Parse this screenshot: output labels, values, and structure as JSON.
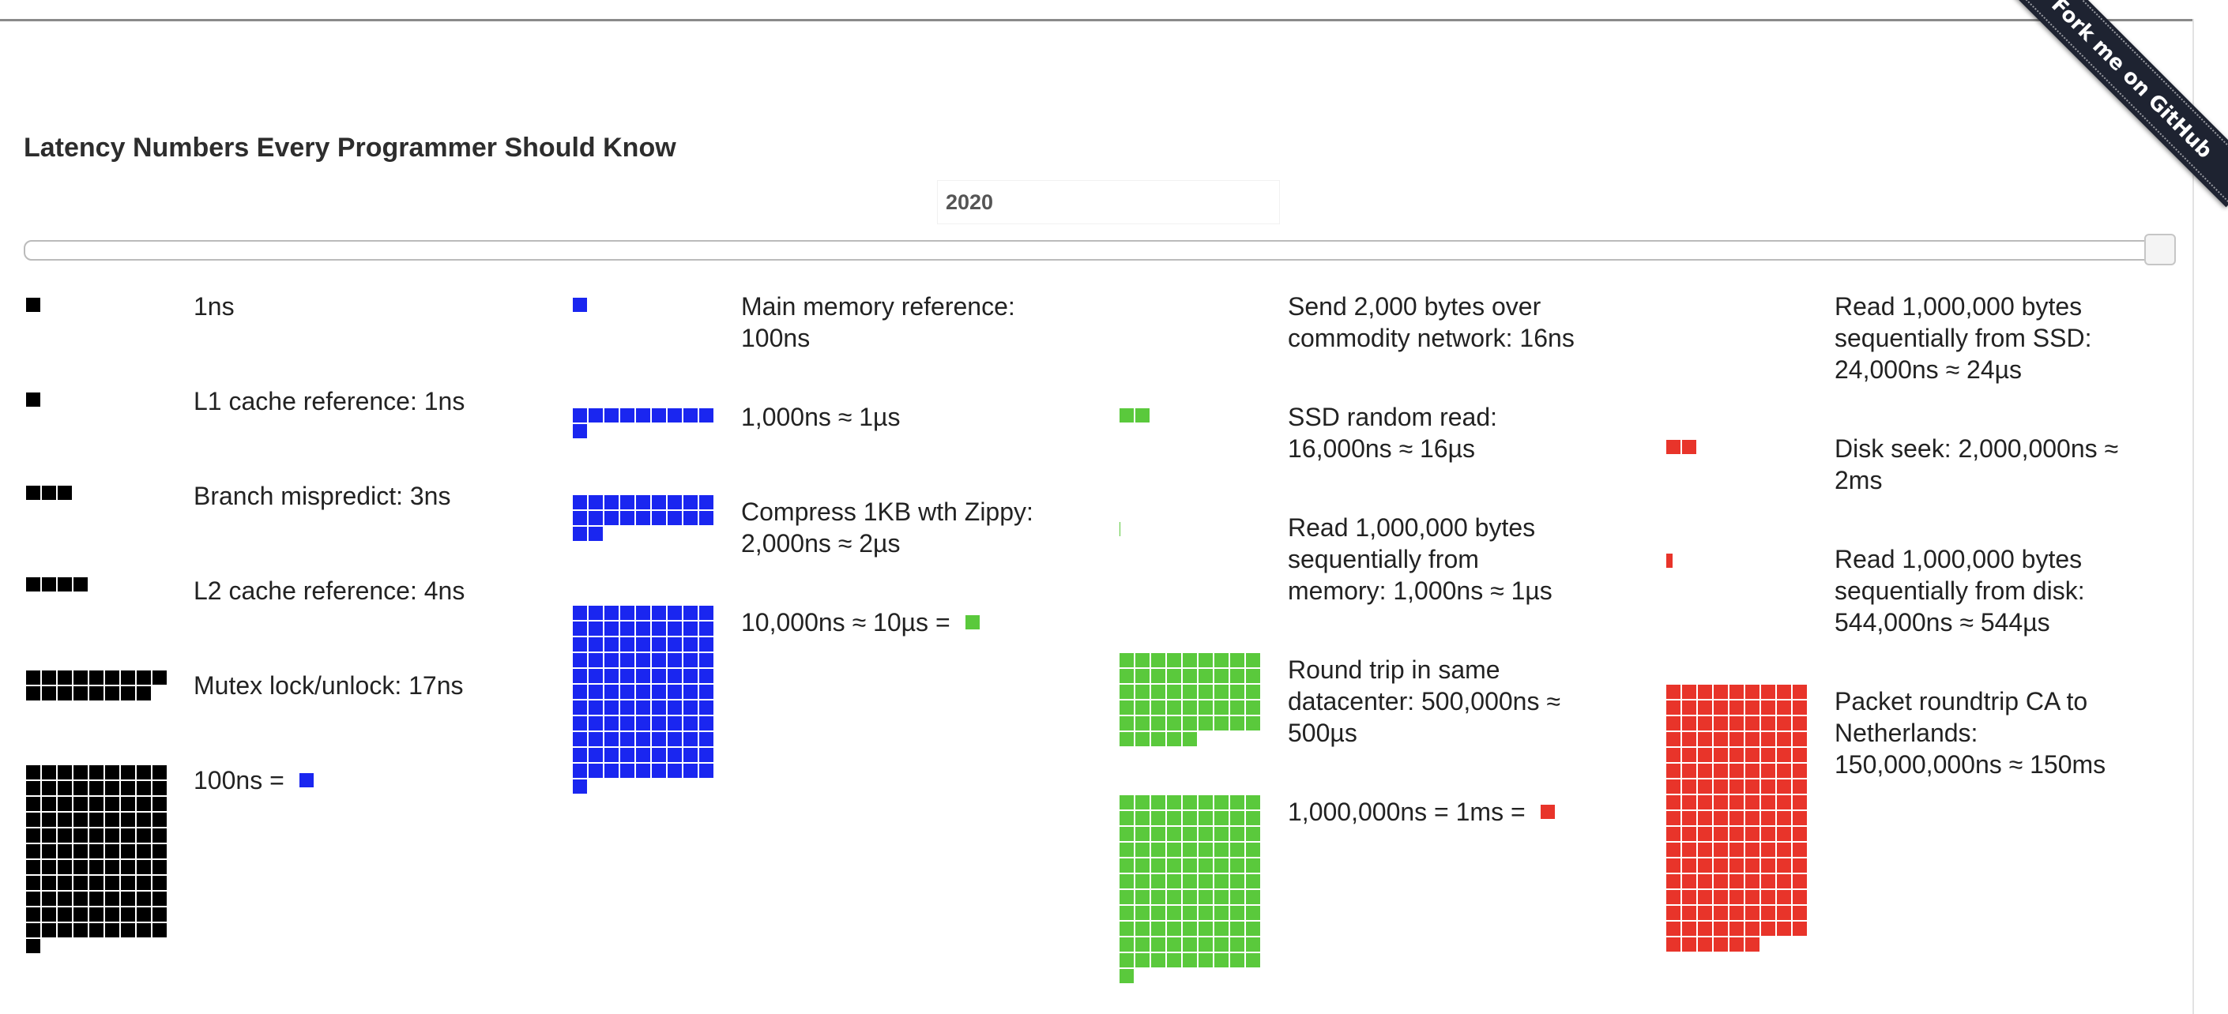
{
  "github_ribbon": "Fork me on GitHub",
  "title": "Latency Numbers Every Programmer Should Know",
  "year": "2020",
  "year_slider": {
    "value": "2020"
  },
  "colors": {
    "black": "#000000",
    "blue": "#1a26f0",
    "green": "#5ac93c",
    "red": "#e8342a"
  },
  "latencies": {
    "one_ns": {
      "label": "1ns",
      "count": 1,
      "color": "black"
    },
    "l1": {
      "label": "L1 cache reference: 1ns",
      "count": 1,
      "color": "black"
    },
    "branch": {
      "label": "Branch mispredict: 3ns",
      "count": 3,
      "color": "black"
    },
    "l2": {
      "label": "L2 cache reference: 4ns",
      "count": 4,
      "color": "black"
    },
    "mutex": {
      "label": "Mutex lock/unlock: 17ns",
      "count": 17,
      "color": "black"
    },
    "hundred_ns": {
      "label": "100ns = ",
      "count": 100,
      "color": "black",
      "equals": "blue"
    },
    "main_memory": {
      "line1": "Main memory reference:",
      "line2": "100ns",
      "count": 1,
      "color": "blue"
    },
    "one_us": {
      "label": "1,000ns ≈ 1µs",
      "count": 10,
      "color": "blue"
    },
    "compress": {
      "line1": "Compress 1KB wth Zippy:",
      "line2": "2,000ns ≈ 2µs",
      "count": 20,
      "color": "blue"
    },
    "ten_us": {
      "label": "10,000ns ≈ 10µs = ",
      "count": 100,
      "color": "blue",
      "equals": "green"
    },
    "network": {
      "line1": "Send 2,000 bytes over",
      "line2": "commodity network: 16ns",
      "count": 0,
      "color": "green"
    },
    "ssd_random": {
      "line1": "SSD random read:",
      "line2": "16,000ns ≈ 16µs",
      "count": 2,
      "color": "green"
    },
    "read_memory": {
      "line1": "Read 1,000,000 bytes",
      "line2": "sequentially from",
      "line3": "memory: 1,000ns ≈ 1µs",
      "count": 0.1,
      "color": "green"
    },
    "round_trip": {
      "line1": "Round trip in same",
      "line2": "datacenter: 500,000ns ≈",
      "line3": "500µs",
      "count": 50,
      "color": "green"
    },
    "one_ms": {
      "label": "1,000,000ns = 1ms = ",
      "count": 100,
      "color": "green",
      "equals": "red"
    },
    "read_ssd": {
      "line1": "Read 1,000,000 bytes",
      "line2": "sequentially from SSD:",
      "line3": "24,000ns ≈ 24µs",
      "count": 0,
      "color": "red"
    },
    "disk_seek": {
      "line1": "Disk seek: 2,000,000ns ≈",
      "line2": "2ms",
      "count": 2,
      "color": "red"
    },
    "read_disk": {
      "line1": "Read 1,000,000 bytes",
      "line2": "sequentially from disk:",
      "line3": "544,000ns ≈ 544µs",
      "count": 0.5,
      "color": "red"
    },
    "packet_rt": {
      "line1": "Packet roundtrip CA to",
      "line2": "Netherlands:",
      "line3": "150,000,000ns ≈ 150ms",
      "count": 150,
      "color": "red"
    }
  }
}
